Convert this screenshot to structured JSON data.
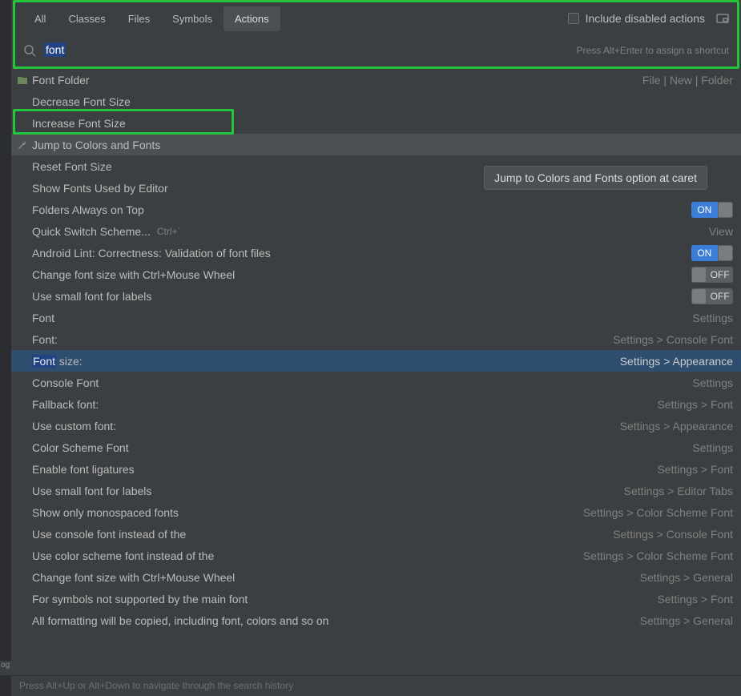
{
  "tabs": {
    "all": "All",
    "classes": "Classes",
    "files": "Files",
    "symbols": "Symbols",
    "actions": "Actions"
  },
  "include_disabled_label": "Include disabled actions",
  "search": {
    "value": "font",
    "hint": "Press Alt+Enter to assign a shortcut"
  },
  "tooltip": "Jump to Colors and Fonts option at caret",
  "footer_hint": "Press Alt+Up or Alt+Down to navigate through the search history",
  "toggle_labels": {
    "on": "ON",
    "off": "OFF"
  },
  "rows": {
    "r0": {
      "label": "Font Folder",
      "right": "File | New | Folder"
    },
    "r1": {
      "label": "Decrease Font Size"
    },
    "r2": {
      "label": "Increase Font Size"
    },
    "r3": {
      "label": "Jump to Colors and Fonts"
    },
    "r4": {
      "label": "Reset Font Size"
    },
    "r5": {
      "label": "Show Fonts Used by Editor"
    },
    "r6": {
      "label": "Folders Always on Top"
    },
    "r7": {
      "label": "Quick Switch Scheme...",
      "shortcut": "Ctrl+`",
      "right": "View"
    },
    "r8": {
      "label": "Android Lint: Correctness: Validation of font files"
    },
    "r9": {
      "label": "Change font size with Ctrl+Mouse Wheel"
    },
    "r10": {
      "label": "Use small font for labels"
    },
    "r11": {
      "label": "Font",
      "right": "Settings"
    },
    "r12": {
      "label": "Font:",
      "right": "Settings > Console Font"
    },
    "r13": {
      "label_hl": "Font",
      "label_rest": " size:",
      "right": "Settings > Appearance"
    },
    "r14": {
      "label": "Console Font",
      "right": "Settings"
    },
    "r15": {
      "label": "Fallback font:",
      "right": "Settings > Font"
    },
    "r16": {
      "label": "Use custom font:",
      "right": "Settings > Appearance"
    },
    "r17": {
      "label": "Color Scheme Font",
      "right": "Settings"
    },
    "r18": {
      "label": "Enable font ligatures",
      "right": "Settings > Font"
    },
    "r19": {
      "label": "Use small font for labels",
      "right": "Settings > Editor Tabs"
    },
    "r20": {
      "label": "Show only monospaced fonts",
      "right": "Settings > Color Scheme Font"
    },
    "r21": {
      "label": "Use console font instead of the",
      "right": "Settings > Console Font"
    },
    "r22": {
      "label": "Use color scheme font instead of the",
      "right": "Settings > Color Scheme Font"
    },
    "r23": {
      "label": "Change font size with Ctrl+Mouse Wheel",
      "right": "Settings > General"
    },
    "r24": {
      "label": "For symbols not supported by the main font",
      "right": "Settings > Font"
    },
    "r25": {
      "label": "All formatting will be copied, including font, colors and so on",
      "right": "Settings > General"
    }
  },
  "gutter_label": "og"
}
